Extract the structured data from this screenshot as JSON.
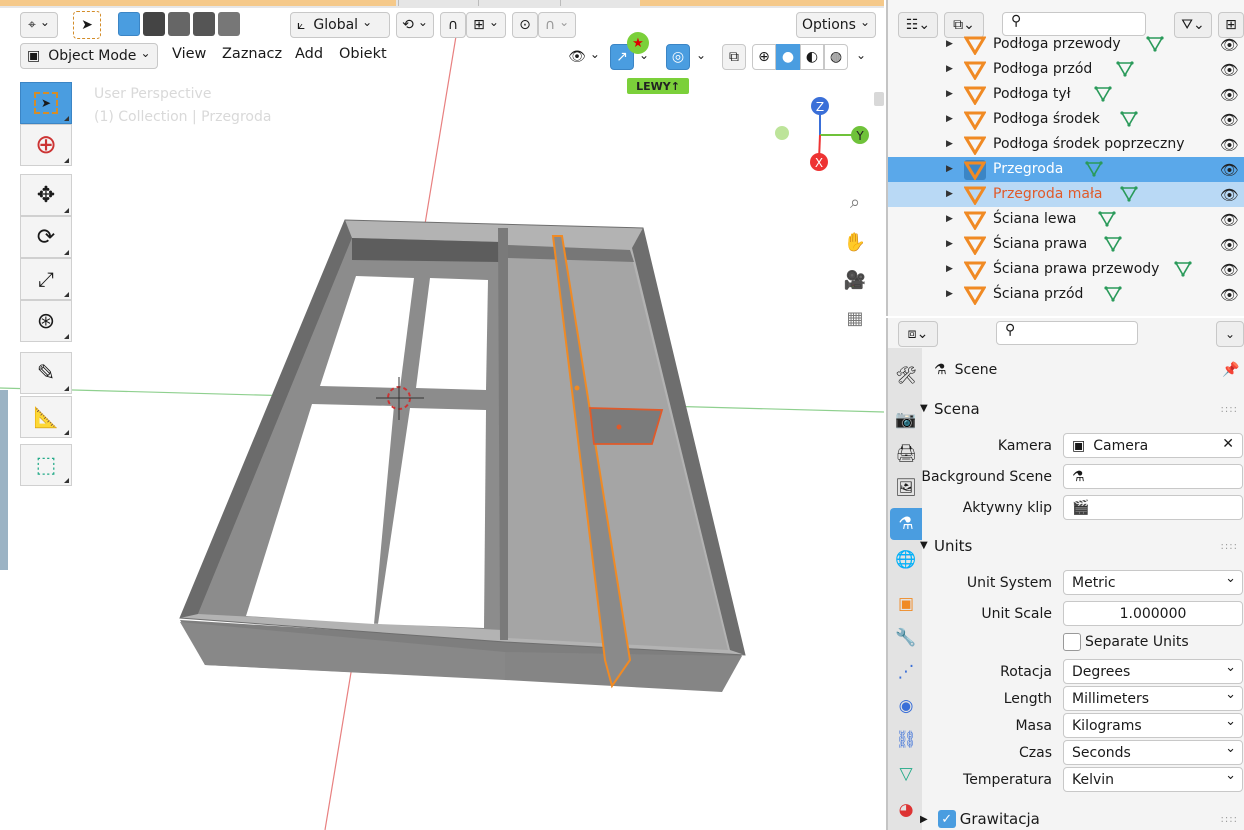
{
  "viewport": {
    "header": {
      "orientation_label": "Global",
      "options_label": "Options"
    },
    "menu": {
      "mode": "Object Mode",
      "view": "View",
      "select": "Zaznacz",
      "add": "Add",
      "object": "Obiekt"
    },
    "overlay_text": {
      "perspective": "User Perspective",
      "collection": "(1) Collection | Przegroda"
    },
    "badge": "LEWY↑",
    "gizmo": {
      "z": "Z",
      "y": "Y",
      "x": "X"
    },
    "accent_color": "#4a9de0",
    "selection_color": "#f08a24"
  },
  "outliner": {
    "items": [
      {
        "label": "Podłoga przewody",
        "selected": false,
        "active": false
      },
      {
        "label": "Podłoga przód",
        "selected": false,
        "active": false
      },
      {
        "label": "Podłoga tył",
        "selected": false,
        "active": false
      },
      {
        "label": "Podłoga środek",
        "selected": false,
        "active": false
      },
      {
        "label": "Podłoga środek poprzeczny",
        "selected": false,
        "active": false
      },
      {
        "label": "Przegroda",
        "selected": true,
        "active": true
      },
      {
        "label": "Przegroda mała",
        "selected": true,
        "active": false
      },
      {
        "label": "Ściana lewa",
        "selected": false,
        "active": false
      },
      {
        "label": "Ściana prawa",
        "selected": false,
        "active": false
      },
      {
        "label": "Ściana prawa przewody",
        "selected": false,
        "active": false
      },
      {
        "label": "Ściana przód",
        "selected": false,
        "active": false
      }
    ]
  },
  "properties": {
    "context_title": "Scene",
    "sections": {
      "scene": "Scena",
      "units": "Units",
      "gravity": "Grawitacja"
    },
    "scene": {
      "camera_label": "Kamera",
      "camera_value": "Camera",
      "background_label": "Background Scene",
      "clip_label": "Aktywny klip"
    },
    "units": {
      "system_label": "Unit System",
      "system_value": "Metric",
      "scale_label": "Unit Scale",
      "scale_value": "1.000000",
      "separate_label": "Separate Units",
      "rotation_label": "Rotacja",
      "rotation_value": "Degrees",
      "length_label": "Length",
      "length_value": "Millimeters",
      "mass_label": "Masa",
      "mass_value": "Kilograms",
      "time_label": "Czas",
      "time_value": "Seconds",
      "temp_label": "Temperatura",
      "temp_value": "Kelvin"
    }
  }
}
